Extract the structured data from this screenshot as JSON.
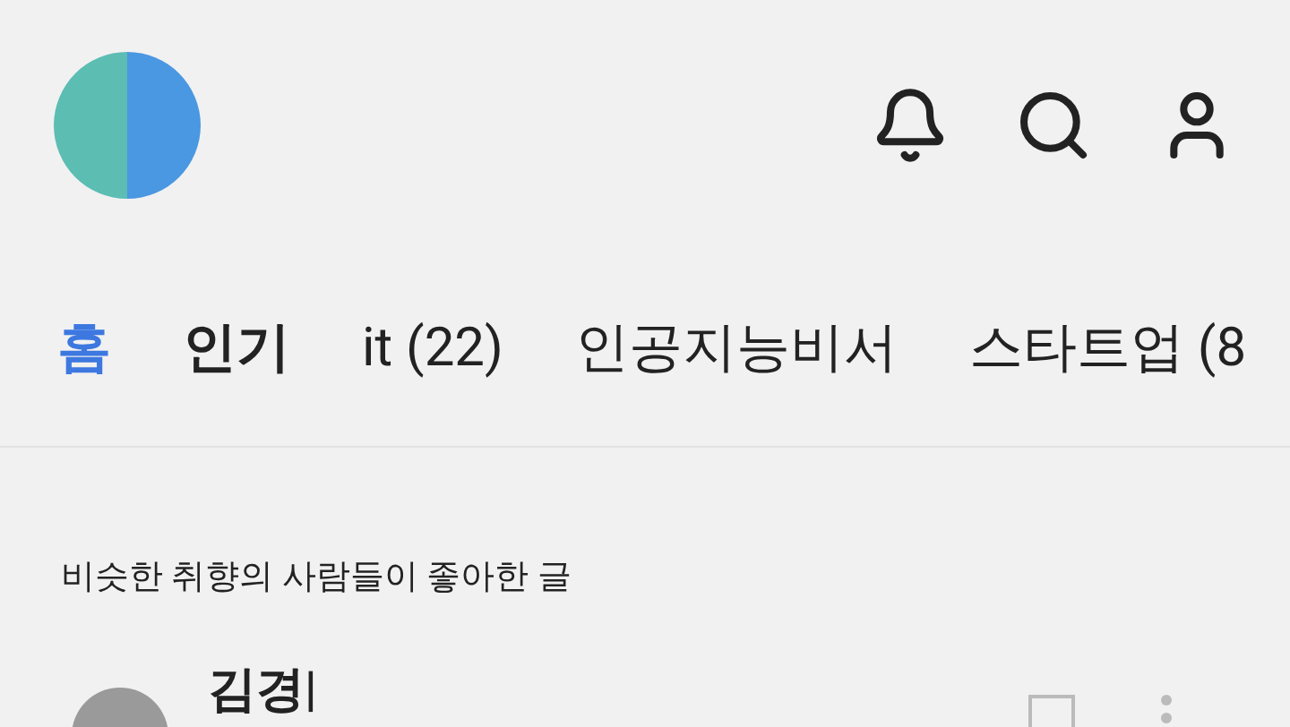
{
  "tabs": [
    {
      "label": "홈",
      "selected": true,
      "emphasized": false
    },
    {
      "label": "인기",
      "selected": false,
      "emphasized": true
    },
    {
      "label": "it (22)",
      "selected": false,
      "emphasized": false
    },
    {
      "label": "인공지능비서",
      "selected": false,
      "emphasized": false
    },
    {
      "label": "스타트업 (8",
      "selected": false,
      "emphasized": false
    }
  ],
  "section": {
    "title": "비슷한 취향의 사람들이 좋아한 글"
  },
  "post": {
    "author": "김경|"
  }
}
